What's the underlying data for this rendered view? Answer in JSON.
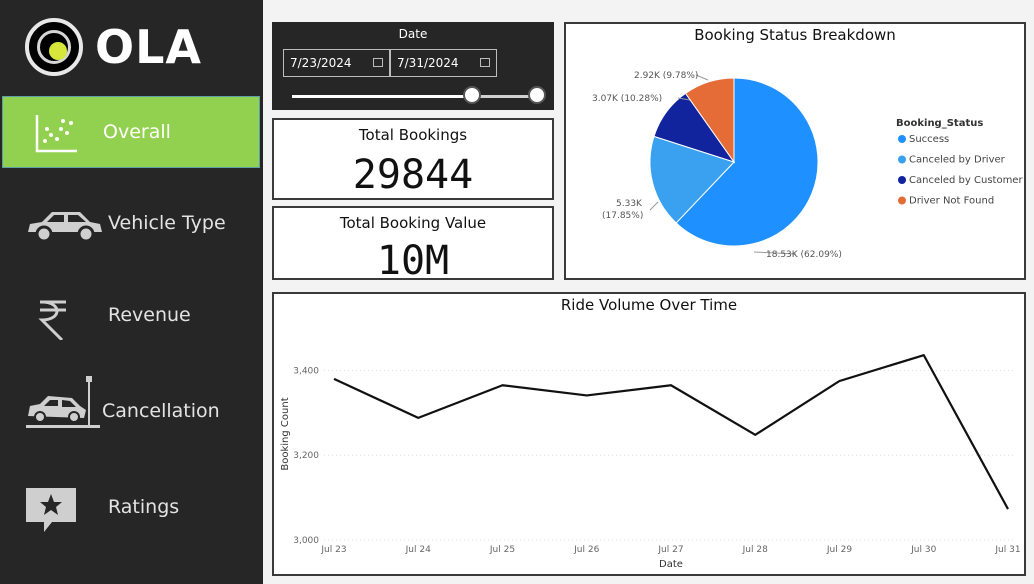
{
  "sidebar": {
    "logo_text": "OLA",
    "items": [
      {
        "label": "Overall",
        "icon": "scatter-chart-icon",
        "active": true
      },
      {
        "label": "Vehicle Type",
        "icon": "car-icon",
        "active": false
      },
      {
        "label": "Revenue",
        "icon": "rupee-icon",
        "active": false
      },
      {
        "label": "Cancellation",
        "icon": "car-crash-icon",
        "active": false
      },
      {
        "label": "Ratings",
        "icon": "star-review-icon",
        "active": false
      }
    ]
  },
  "date_filter": {
    "title": "Date",
    "start": "7/23/2024",
    "end": "7/31/2024"
  },
  "kpis": {
    "total_bookings": {
      "title": "Total Bookings",
      "value": "29844"
    },
    "total_booking_value": {
      "title": "Total Booking Value",
      "value": "10M"
    }
  },
  "colors": {
    "accent": "#92d050",
    "sidebar_bg": "#262626",
    "success": "#1e90ff",
    "canceled_by_driver": "#3aa0f0",
    "canceled_by_customer": "#12239e",
    "driver_not_found": "#e66c37"
  },
  "chart_data": [
    {
      "type": "pie",
      "title": "Booking Status Breakdown",
      "legend_title": "Booking_Status",
      "legend_position": "right",
      "slices": [
        {
          "name": "Success",
          "value": 18530,
          "label": "18.53K (62.09%)",
          "color": "#1e90ff"
        },
        {
          "name": "Canceled by Driver",
          "value": 5330,
          "label": "5.33K (17.85%)",
          "color": "#3aa0f0"
        },
        {
          "name": "Canceled by Customer",
          "value": 3070,
          "label": "3.07K (10.28%)",
          "color": "#12239e"
        },
        {
          "name": "Driver Not Found",
          "value": 2920,
          "label": "2.92K (9.78%)",
          "color": "#e66c37"
        }
      ]
    },
    {
      "type": "line",
      "title": "Ride Volume Over Time",
      "xlabel": "Date",
      "ylabel": "Booking Count",
      "categories": [
        "Jul 23",
        "Jul 24",
        "Jul 25",
        "Jul 26",
        "Jul 27",
        "Jul 28",
        "Jul 29",
        "Jul 30",
        "Jul 31"
      ],
      "values": [
        3380,
        3288,
        3365,
        3341,
        3365,
        3248,
        3375,
        3436,
        3073
      ],
      "ylim": [
        3000,
        3500
      ],
      "yticks": [
        3000,
        3200,
        3400
      ],
      "ytick_labels": [
        "3,000",
        "3,200",
        "3,400"
      ],
      "grid": true
    }
  ]
}
